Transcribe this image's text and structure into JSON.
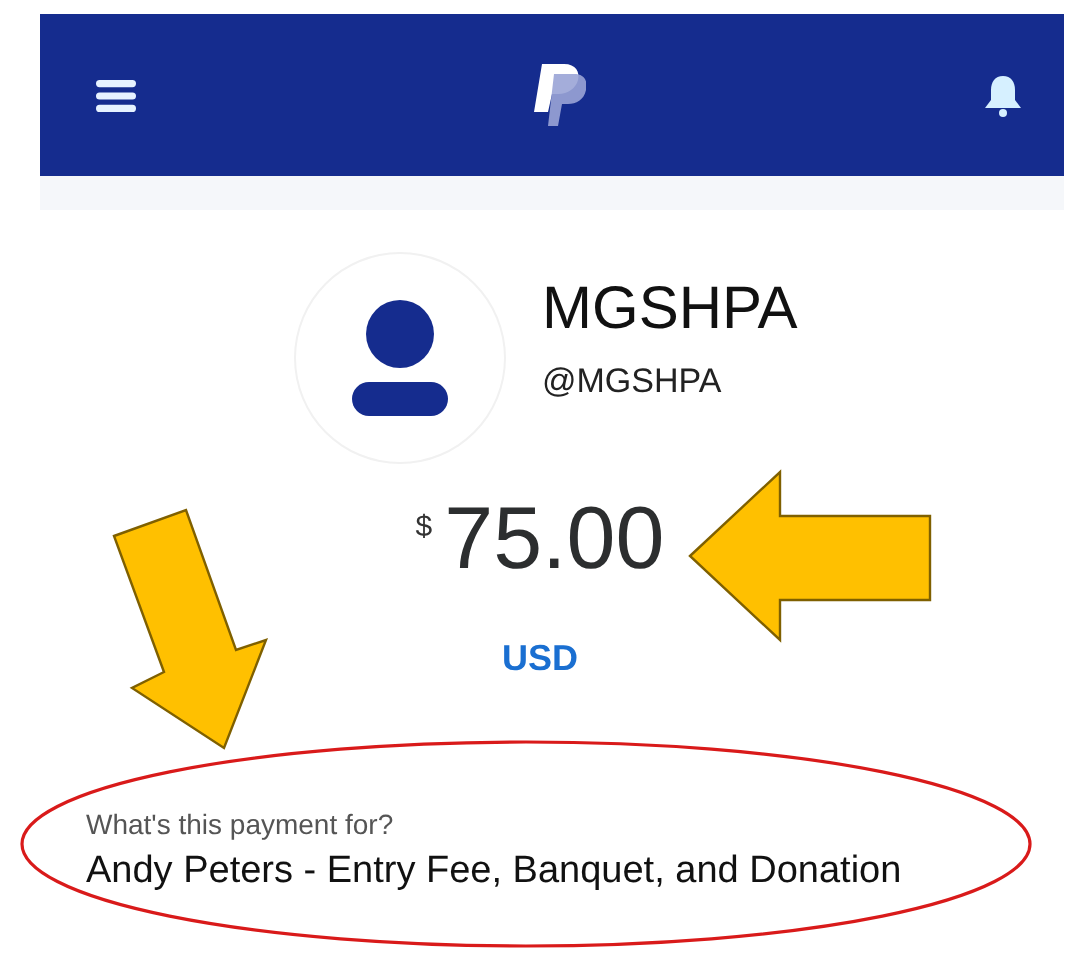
{
  "recipient": {
    "name": "MGSHPA",
    "handle": "@MGSHPA"
  },
  "amount": {
    "symbol": "$",
    "value": "75.00",
    "currency": "USD"
  },
  "note": {
    "label": "What's this payment for?",
    "text": "Andy Peters - Entry Fee, Banquet, and Donation"
  }
}
